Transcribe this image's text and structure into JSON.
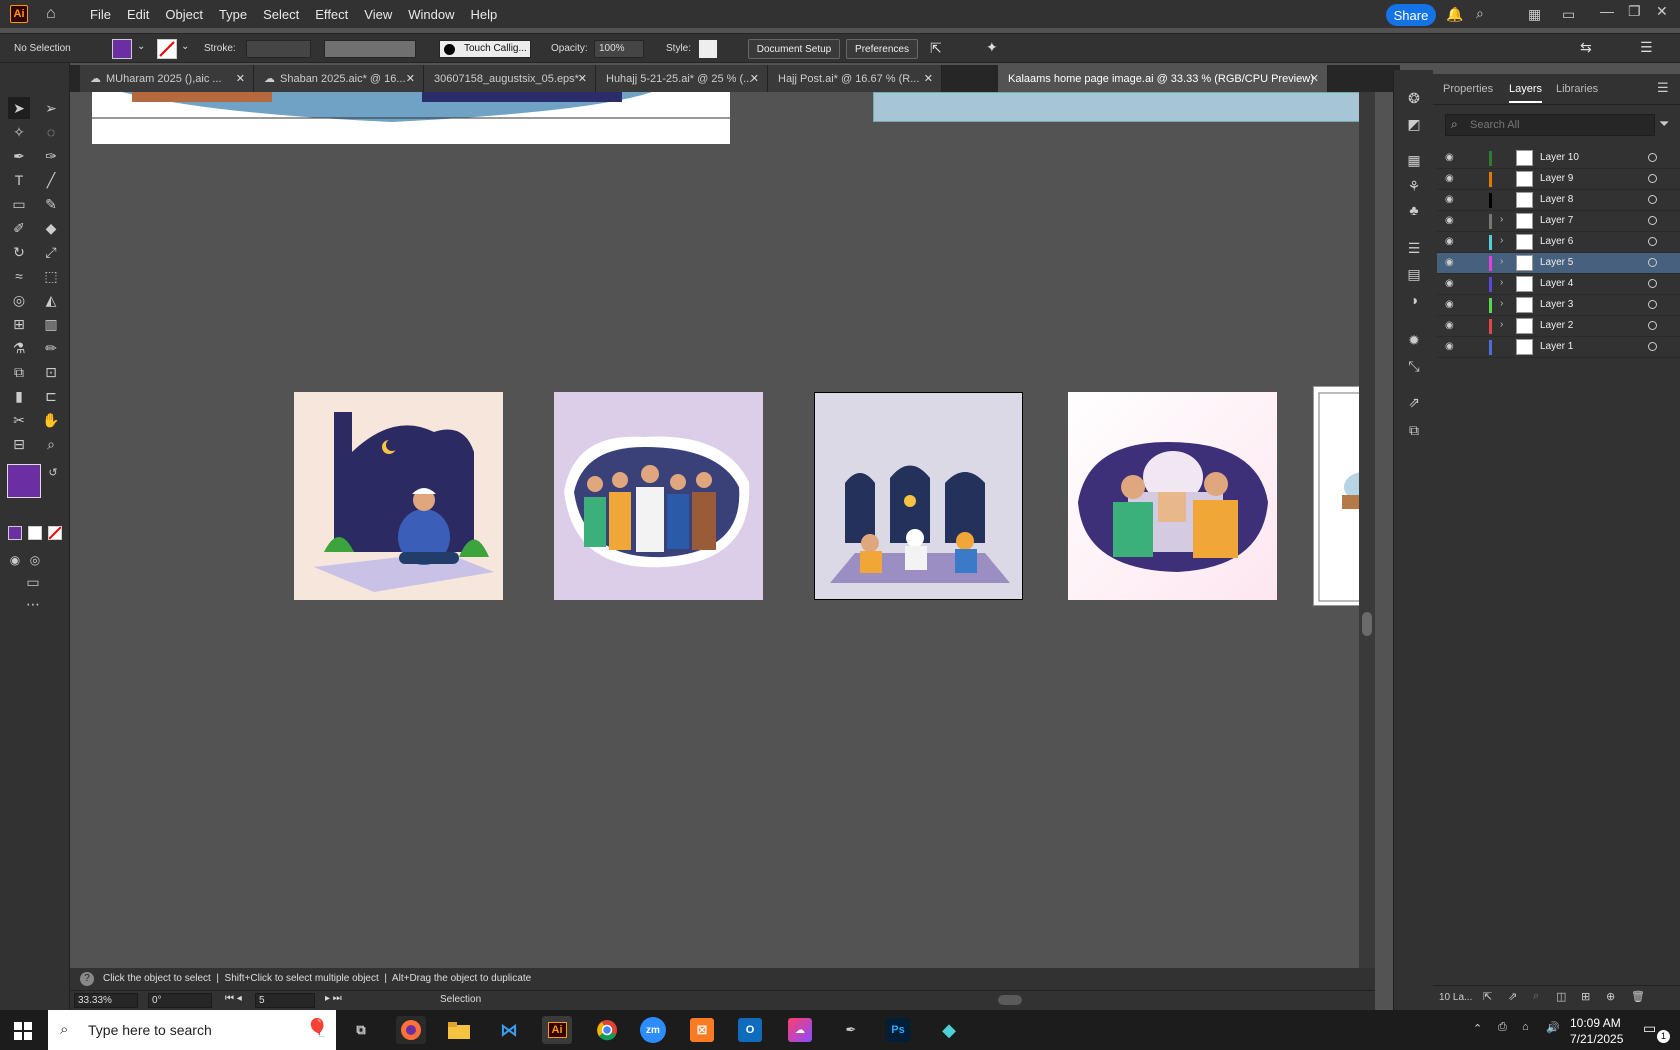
{
  "app": {
    "logo": "Ai",
    "menu": [
      "File",
      "Edit",
      "Object",
      "Type",
      "Select",
      "Effect",
      "View",
      "Window",
      "Help"
    ],
    "share": "Share"
  },
  "control": {
    "selection": "No Selection",
    "stroke_label": "Stroke:",
    "brush": "Touch Callig...",
    "opacity_label": "Opacity:",
    "opacity": "100%",
    "style_label": "Style:",
    "document_setup": "Document Setup",
    "preferences": "Preferences",
    "fill_color": "#6b2fa3"
  },
  "tabs": [
    {
      "label": "MUharam 2025 (),aic ..."
    },
    {
      "label": "Shaban 2025.aic* @ 16..."
    },
    {
      "label": "30607158_augustsix_05.eps*"
    },
    {
      "label": "Huhajj 5-21-25.ai* @ 25 % (..."
    },
    {
      "label": "Hajj Post.ai* @ 16.67 % (R..."
    },
    {
      "label": "Kalaams home page image.ai @ 33.33 % (RGB/CPU Preview)"
    }
  ],
  "panel": {
    "tabs": [
      "Properties",
      "Layers",
      "Libraries"
    ],
    "search_placeholder": "Search All",
    "footer": "10 La..."
  },
  "layers": [
    {
      "name": "Layer 10",
      "color": "#2f7d32"
    },
    {
      "name": "Layer 9",
      "color": "#e07b00"
    },
    {
      "name": "Layer 8",
      "color": "#000000"
    },
    {
      "name": "Layer 7",
      "color": "#777777"
    },
    {
      "name": "Layer 6",
      "color": "#4fd0d8"
    },
    {
      "name": "Layer 5",
      "color": "#e040e0"
    },
    {
      "name": "Layer 4",
      "color": "#5b48d8"
    },
    {
      "name": "Layer 3",
      "color": "#57d94c"
    },
    {
      "name": "Layer 2",
      "color": "#e04848"
    },
    {
      "name": "Layer 1",
      "color": "#4a6fd8"
    }
  ],
  "status": {
    "hint": "Click the object to select  |  Shift+Click to select multiple object  |  Alt+Drag the object to duplicate",
    "zoom": "33.33%",
    "rotation": "0°",
    "artboard": "5",
    "tool": "Selection"
  },
  "taskbar": {
    "search": "Type here to search",
    "time": "10:09 AM",
    "date": "7/21/2025",
    "notifications": "1"
  }
}
